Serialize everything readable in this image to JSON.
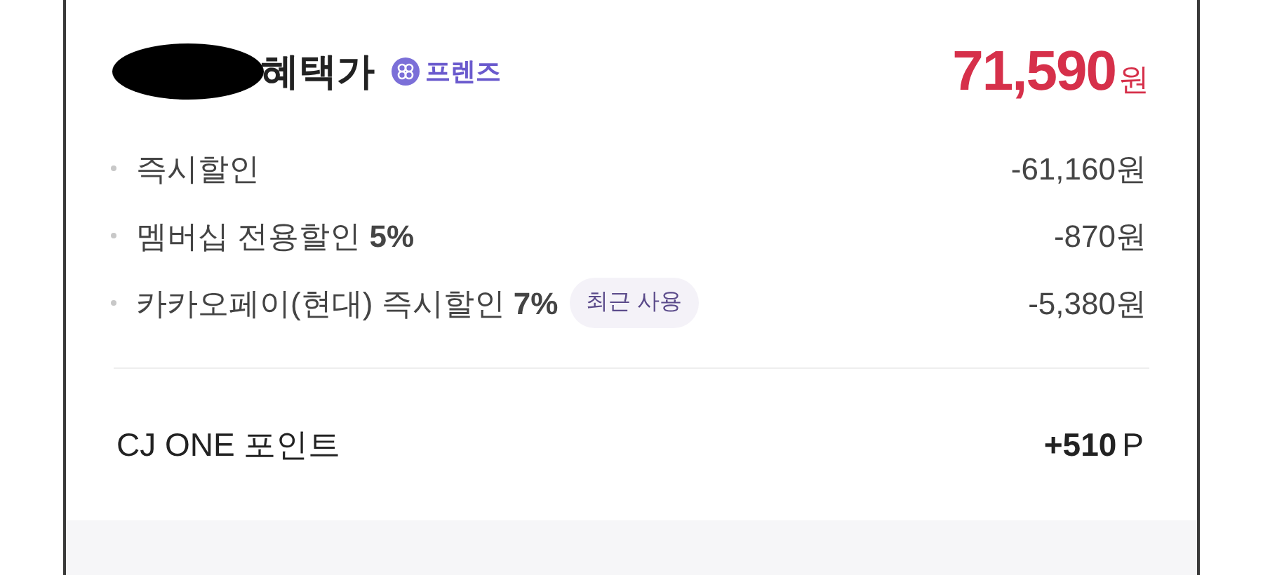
{
  "header": {
    "title": "혜택가",
    "badge": "프렌즈",
    "price": "71,590",
    "price_unit": "원"
  },
  "discounts": [
    {
      "label": "즉시할인",
      "amount": "-61,160원"
    },
    {
      "label": "멤버십 전용할인 **5%**",
      "amount": "-870원"
    },
    {
      "label": "카카오페이(현대) 즉시할인 **7%**",
      "tag": "최근 사용",
      "amount": "-5,380원"
    }
  ],
  "points": {
    "label": "CJ ONE 포인트",
    "amount": "+510",
    "unit": "P"
  }
}
